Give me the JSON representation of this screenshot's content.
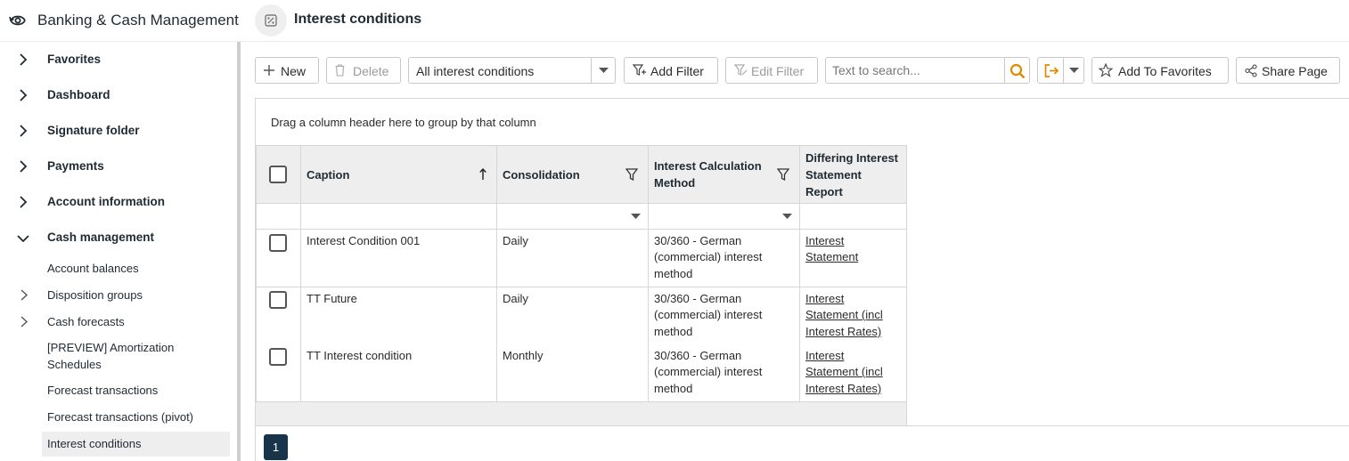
{
  "header": {
    "app_title": "Banking & Cash Management",
    "page_title": "Interest conditions",
    "app_icon": "eye-sync-icon",
    "page_icon": "percent-doc-icon"
  },
  "sidebar": {
    "top_items": [
      {
        "label": "Favorites",
        "expanded": false
      },
      {
        "label": "Dashboard",
        "expanded": false
      },
      {
        "label": "Signature folder",
        "expanded": false
      },
      {
        "label": "Payments",
        "expanded": false
      },
      {
        "label": "Account information",
        "expanded": false
      },
      {
        "label": "Cash management",
        "expanded": true
      }
    ],
    "sub_items": [
      {
        "label": "Account balances",
        "has_children": false
      },
      {
        "label": "Disposition groups",
        "has_children": true
      },
      {
        "label": "Cash forecasts",
        "has_children": true
      },
      {
        "label": "[PREVIEW] Amortization Schedules",
        "has_children": false
      },
      {
        "label": "Forecast transactions",
        "has_children": false
      },
      {
        "label": "Forecast transactions (pivot)",
        "has_children": false
      },
      {
        "label": "Interest conditions",
        "has_children": false,
        "active": true
      }
    ]
  },
  "toolbar": {
    "new_label": "New",
    "delete_label": "Delete",
    "view_select_value": "All interest conditions",
    "add_filter_label": "Add Filter",
    "edit_filter_label": "Edit Filter",
    "search_placeholder": "Text to search...",
    "add_favorites_label": "Add To Favorites",
    "share_label": "Share Page",
    "accent_color": "#e08a00"
  },
  "grid": {
    "group_hint": "Drag a column header here to group by that column",
    "columns": {
      "caption": "Caption",
      "consolidation": "Consolidation",
      "method_line1": "Interest Calculation",
      "method_line2": "Method",
      "report_line1": "Differing Interest",
      "report_line2": "Statement",
      "report_line3": "Report"
    },
    "rows": [
      {
        "caption": "Interest Condition 001",
        "consolidation": "Daily",
        "method_1": "30/360 - German",
        "method_2": "(commercial) interest",
        "method_3": "method",
        "report_1": "Interest",
        "report_2": "Statement",
        "report_3": ""
      },
      {
        "caption": "TT Future",
        "consolidation": "Daily",
        "method_1": "30/360 - German",
        "method_2": "(commercial) interest",
        "method_3": "method",
        "report_1": "Interest",
        "report_2": "Statement (incl",
        "report_3": "Interest Rates)"
      },
      {
        "caption": "TT Interest condition",
        "consolidation": "Monthly",
        "method_1": "30/360 - German",
        "method_2": "(commercial) interest",
        "method_3": "method",
        "report_1": "Interest",
        "report_2": "Statement (incl",
        "report_3": "Interest Rates)"
      }
    ],
    "current_page": "1"
  }
}
